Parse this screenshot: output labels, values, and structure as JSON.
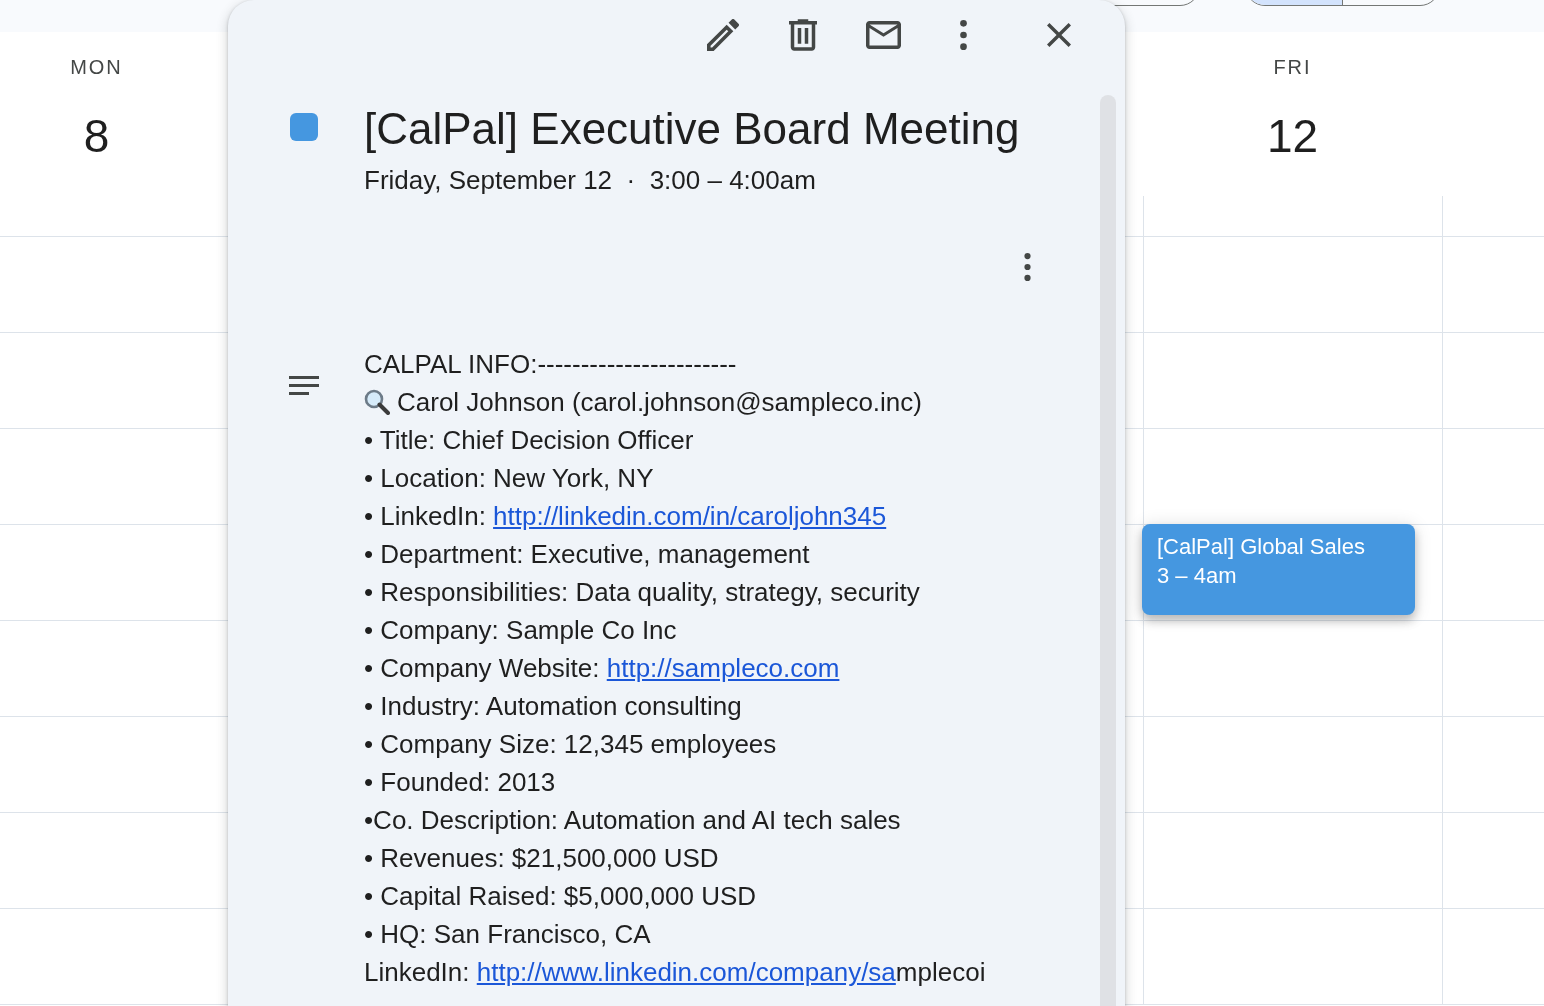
{
  "header": {
    "segments": [
      {
        "selected": true
      },
      {
        "selected": false
      }
    ]
  },
  "calendar": {
    "days": [
      {
        "name": "MON",
        "date": "8"
      },
      {
        "name": "FRI",
        "date": "12",
        "events": [
          {
            "title": "[CalPal] Global Sales",
            "time": "3 – 4am",
            "color": "#4597e0"
          }
        ]
      }
    ]
  },
  "event_popup": {
    "title": "[CalPal] Executive Board Meeting",
    "color": "#4597e0",
    "when": "Friday, September 12  ·  3:00 – 4:00am",
    "description": [
      {
        "kind": "text",
        "text": "CALPAL INFO:-----------------------"
      },
      {
        "kind": "search",
        "text": "Carol Johnson (carol.johnson@sampleco.inc)"
      },
      {
        "kind": "text",
        "text": "• Title: Chief Decision Officer"
      },
      {
        "kind": "text",
        "text": "• Location: New York, NY"
      },
      {
        "kind": "text",
        "text": "• LinkedIn: ",
        "link": "http://linkedin.com/in/caroljohn345"
      },
      {
        "kind": "text",
        "text": "• Department: Executive, management"
      },
      {
        "kind": "text",
        "text": "• Responsibilities: Data quality, strategy, security"
      },
      {
        "kind": "text",
        "text": "• Company: Sample Co Inc"
      },
      {
        "kind": "text",
        "text": "• Company Website: ",
        "link": "http://sampleco.com"
      },
      {
        "kind": "text",
        "text": "• Industry: Automation consulting"
      },
      {
        "kind": "text",
        "text": "• Company Size: 12,345 employees"
      },
      {
        "kind": "text",
        "text": "• Founded: 2013"
      },
      {
        "kind": "text",
        "text": "•Co. Description: Automation and AI tech sales"
      },
      {
        "kind": "text",
        "text": "• Revenues: $21,500,000 USD"
      },
      {
        "kind": "text",
        "text": "• Capital Raised: $5,000,000 USD"
      },
      {
        "kind": "text",
        "text": "• HQ: San Francisco, CA"
      },
      {
        "kind": "text",
        "text": "LinkedIn: ",
        "link": "http://www.linkedin.com/company/sa",
        "tail": "mplecoi"
      }
    ]
  }
}
